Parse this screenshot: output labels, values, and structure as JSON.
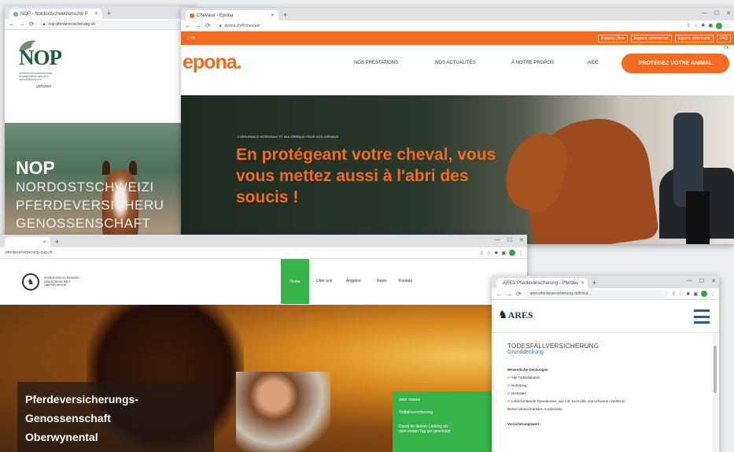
{
  "nop": {
    "tab_title": "NOP - Nordostschweizerische P",
    "url": "nop-pferdeversicherung.ch",
    "logo": "NOP",
    "logo_tagline": "NORDOSTSCHWEIZERISCHE PFERDEVERSICHERUNGS GENOSSENSCHAFT",
    "logo_script": "galloped",
    "hero_title": "NOP",
    "hero_line1": "NORDOSTSCHWEIZI",
    "hero_line2": "PFERDEVERSICHERU",
    "hero_line3": "GENOSSENSCHAFT"
  },
  "epona": {
    "tab_title": "Chevaux - Epona",
    "url": "epona.ch/fr/chevaux",
    "top_links": [
      "Espace client",
      "Espace commercial",
      "Espace vétérinaire",
      "FAQ"
    ],
    "lang": "DE",
    "logo": "epona.",
    "nav": [
      "NOS PRESTATIONS",
      "NOS ACTUALITÉS",
      "À NOTRE PROPOS",
      "AIDE"
    ],
    "cta": "PROTÉGEZ VOTRE ANIMAL",
    "kicker": "L'ASSURANCE INTÉGRALE ET MULTIRISQUE POUR VOS CHEVAUX",
    "headline1": "En protégeant votre cheval, vous",
    "headline2": "vous mettez aussi à l'abri des",
    "headline3": "soucis !",
    "colors": {
      "brand": "#f26b21"
    }
  },
  "oberwynental": {
    "url": "pferdeversicherung-oag.ch",
    "logo_text1": "PFERDEVERSICHERUNGS-",
    "logo_text2": "GENOSSENSCHAFT",
    "logo_text3": "OBERWYNENTAL",
    "nav_active": "Home",
    "nav": [
      "Über uns",
      "Angebot",
      "News",
      "Kontakt"
    ],
    "hero_line1": "Pferdeversicherungs-",
    "hero_line2": "Genossenschaft",
    "hero_line3": "Oberwynental",
    "panel_title": "Jetzt wissen",
    "panel_line": "Todfallversicherung",
    "panel_body1": "Damit Ihr kleiner Liebling ab",
    "panel_body2": "dem ersten Tag gut geschützt",
    "colors": {
      "accent": "#35b44a"
    }
  },
  "ares": {
    "tab_title": "ARES Pferdeversicherung - Pferdev",
    "url": "ares-pferdeversicherung.ch/fr/tod...",
    "logo": "ARES",
    "section_title": "TODESFALLVERSICHERUNG",
    "section_sub": "Grunddeckung",
    "list_heading": "Wesentliche Deckungen",
    "items": [
      "Alle Todesfallarten",
      "Nottötung",
      "Diebstahl",
      "Lebensrettende Operationen, wie z.B. bei Kolik- und schweren Verletzun"
    ],
    "item_note": "Rente unbeschränkten Ausdeckten",
    "footer_heading": "Versicherungswert"
  }
}
